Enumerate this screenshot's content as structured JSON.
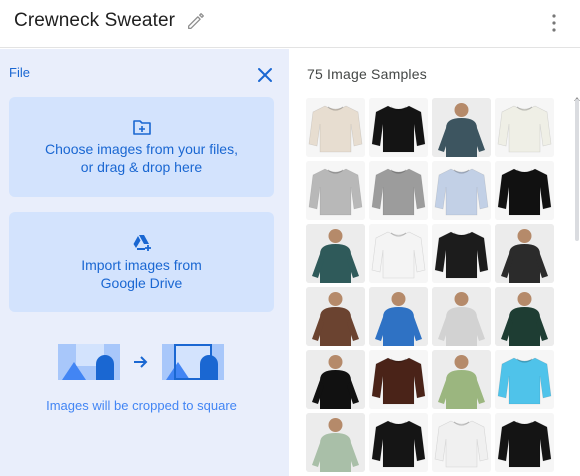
{
  "header": {
    "title": "Crewneck Sweater"
  },
  "upload_panel": {
    "file_label": "File",
    "choose_files": {
      "icon": "folder-plus-icon",
      "line1": "Choose images from your files,",
      "line2": "or drag & drop here"
    },
    "import_drive": {
      "icon": "google-drive-add-icon",
      "line1": "Import images from",
      "line2": "Google Drive"
    },
    "crop_note": "Images will be cropped to square"
  },
  "samples": {
    "title": "75 Image Samples",
    "tiles": [
      {
        "color": "#e7ddd0",
        "kind": "sweater"
      },
      {
        "color": "#141414",
        "kind": "sweater"
      },
      {
        "color": "#3d5560",
        "kind": "person"
      },
      {
        "color": "#efefe6",
        "kind": "sweater"
      },
      {
        "color": "#b8b8b8",
        "kind": "sweater"
      },
      {
        "color": "#9c9c9c",
        "kind": "sweater"
      },
      {
        "color": "#c2d0e6",
        "kind": "sweater"
      },
      {
        "color": "#111111",
        "kind": "sweater"
      },
      {
        "color": "#2f5a5a",
        "kind": "person"
      },
      {
        "color": "#f4f4f4",
        "kind": "sweater"
      },
      {
        "color": "#1c1c1c",
        "kind": "sweater"
      },
      {
        "color": "#2b2b2b",
        "kind": "person"
      },
      {
        "color": "#6b4330",
        "kind": "person"
      },
      {
        "color": "#2f72c4",
        "kind": "person"
      },
      {
        "color": "#d2d2d2",
        "kind": "person"
      },
      {
        "color": "#1e3d33",
        "kind": "person"
      },
      {
        "color": "#111111",
        "kind": "person"
      },
      {
        "color": "#4a2318",
        "kind": "sweater"
      },
      {
        "color": "#9bb67f",
        "kind": "person"
      },
      {
        "color": "#4fc3ea",
        "kind": "sweater"
      },
      {
        "color": "#a9bfa8",
        "kind": "person"
      },
      {
        "color": "#151515",
        "kind": "sweater"
      },
      {
        "color": "#f0f0f0",
        "kind": "sweater"
      },
      {
        "color": "#141414",
        "kind": "sweater"
      }
    ]
  },
  "colors": {
    "panel_bg": "#e9eefb",
    "card_bg": "#d3e3fd",
    "accent": "#1a67d2"
  }
}
